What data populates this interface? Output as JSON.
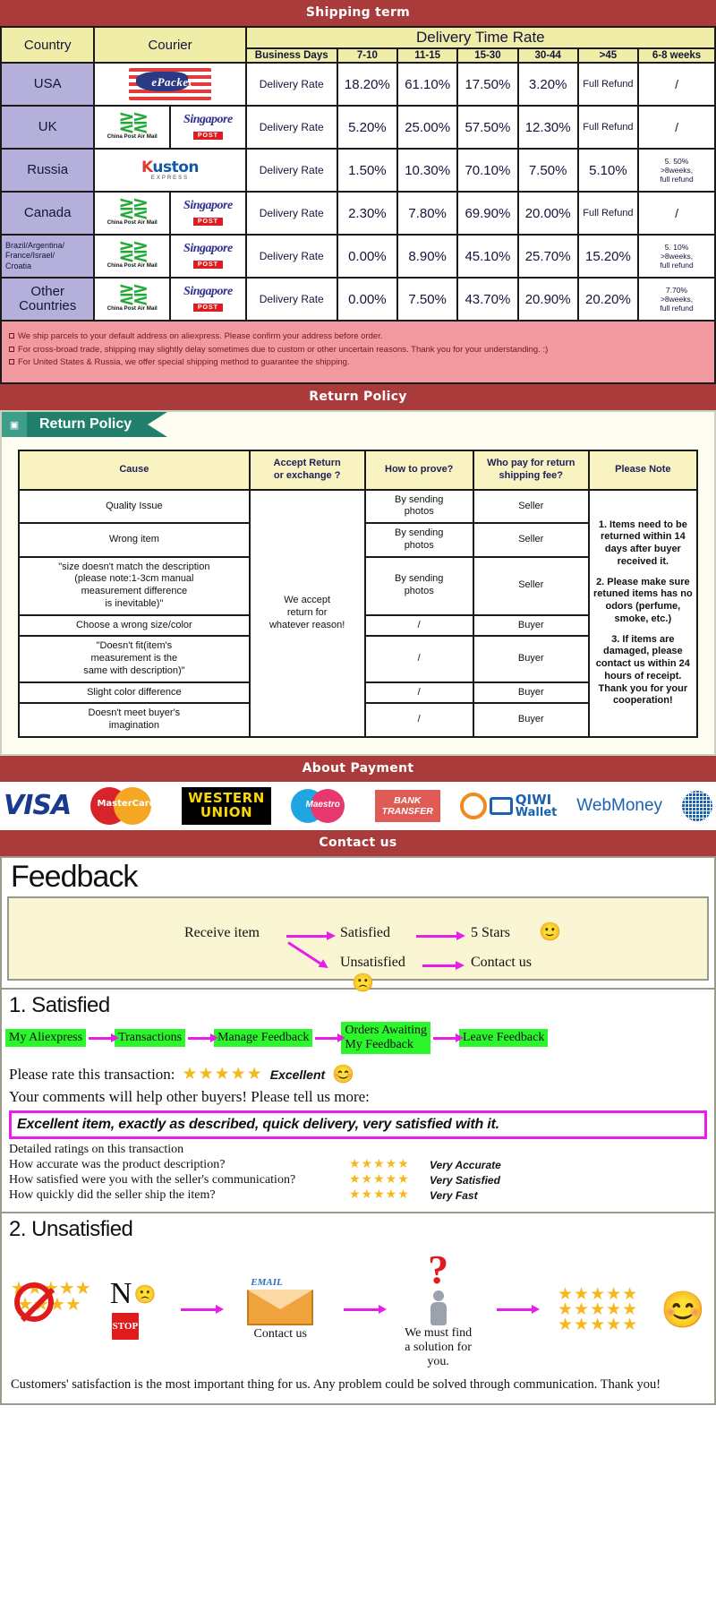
{
  "banners": {
    "shipping": "Shipping term",
    "return": "Return Policy",
    "payment": "About Payment",
    "contact": "Contact us"
  },
  "shipping_table": {
    "headers": {
      "country": "Country",
      "courier": "Courier",
      "delivery_time_rate": "Delivery Time Rate",
      "business_days": "Business Days",
      "ranges": [
        "7-10",
        "11-15",
        "15-30",
        "30-44",
        ">45",
        "6-8 weeks"
      ]
    },
    "rows": [
      {
        "country": "USA",
        "country_small": false,
        "couriers": [
          "epacket"
        ],
        "rate_label": "Delivery Rate",
        "values": [
          "18.20%",
          "61.10%",
          "17.50%",
          "3.20%",
          "Full Refund",
          "/"
        ],
        "last_note": ""
      },
      {
        "country": "UK",
        "country_small": false,
        "couriers": [
          "china-post-air-mail",
          "singapore-post"
        ],
        "rate_label": "Delivery Rate",
        "values": [
          "5.20%",
          "25.00%",
          "57.50%",
          "12.30%",
          "Full Refund",
          "/"
        ],
        "last_note": ""
      },
      {
        "country": "Russia",
        "country_small": false,
        "couriers": [
          "kuston-express"
        ],
        "rate_label": "Delivery Rate",
        "values": [
          "1.50%",
          "10.30%",
          "70.10%",
          "7.50%",
          "5.10%",
          ""
        ],
        "last_note": "5. 50%\n>8weeks,\nfull refund"
      },
      {
        "country": "Canada",
        "country_small": false,
        "couriers": [
          "china-post-air-mail",
          "singapore-post"
        ],
        "rate_label": "Delivery Rate",
        "values": [
          "2.30%",
          "7.80%",
          "69.90%",
          "20.00%",
          "Full Refund",
          "/"
        ],
        "last_note": ""
      },
      {
        "country": "Brazil/Argentina/\nFrance/Israel/\nCroatia",
        "country_small": true,
        "couriers": [
          "china-post-air-mail",
          "singapore-post"
        ],
        "rate_label": "Delivery Rate",
        "values": [
          "0.00%",
          "8.90%",
          "45.10%",
          "25.70%",
          "15.20%",
          ""
        ],
        "last_note": "5. 10%\n>8weeks,\nfull refund"
      },
      {
        "country": "Other Countries",
        "country_small": false,
        "couriers": [
          "china-post-air-mail",
          "singapore-post"
        ],
        "rate_label": "Delivery Rate",
        "values": [
          "0.00%",
          "7.50%",
          "43.70%",
          "20.90%",
          "20.20%",
          ""
        ],
        "last_note": "7.70%\n>8weeks,\nfull refund"
      }
    ],
    "notes": [
      "We ship parcels to your default address on aliexpress. Please confirm your address before order.",
      "For cross-broad trade, shipping may slightly delay sometimes due to custom or other uncertain reasons. Thank you for your understanding. :)",
      "For United States & Russia, we offer special shipping method to guarantee the shipping."
    ]
  },
  "return_policy": {
    "tag_label": "Return Policy",
    "headers": [
      "Cause",
      "Accept Return\nor exchange ?",
      "How to prove?",
      "Who pay for return\nshipping fee?",
      "Please Note"
    ],
    "accept_text": "We accept\nreturn for\nwhatever reason!",
    "rows": [
      {
        "cause": "Quality Issue",
        "prove": "By sending\nphotos",
        "who_pays": "Seller"
      },
      {
        "cause": "Wrong item",
        "prove": "By sending\nphotos",
        "who_pays": "Seller"
      },
      {
        "cause": "\"size doesn't match the description\n(please note:1-3cm manual\nmeasurement difference\nis inevitable)\"",
        "prove": "By sending\nphotos",
        "who_pays": "Seller"
      },
      {
        "cause": "Choose a wrong size/color",
        "prove": "/",
        "who_pays": "Buyer"
      },
      {
        "cause": "\"Doesn't fit(item's\nmeasurement is the\nsame with description)\"",
        "prove": "/",
        "who_pays": "Buyer"
      },
      {
        "cause": "Slight color difference",
        "prove": "/",
        "who_pays": "Buyer"
      },
      {
        "cause": "Doesn't meet buyer's\nimagination",
        "prove": "/",
        "who_pays": "Buyer"
      }
    ],
    "notes": [
      "1. Items need to be returned within 14 days after buyer received it.",
      "2. Please make sure retuned items has no odors (perfume, smoke, etc.)",
      "3. If items are damaged, please contact us within 24 hours of receipt. Thank you for your cooperation!"
    ]
  },
  "payment_methods": [
    {
      "name": "visa",
      "label": "VISA"
    },
    {
      "name": "mastercard",
      "label": "MasterCard"
    },
    {
      "name": "western-union",
      "label_line1": "WESTERN",
      "label_line2": "UNION"
    },
    {
      "name": "maestro",
      "label": "Maestro"
    },
    {
      "name": "bank-transfer",
      "label_line1": "BANK",
      "label_line2": "TRANSFER"
    },
    {
      "name": "qiwi-wallet",
      "label_line1": "QIWI",
      "label_line2": "Wallet"
    },
    {
      "name": "webmoney",
      "label": "WebMoney"
    },
    {
      "name": "globe",
      "label": ""
    }
  ],
  "feedback": {
    "title": "Feedback",
    "flow": {
      "receive": "Receive item",
      "satisfied": "Satisfied",
      "five_stars": "5 Stars",
      "unsatisfied": "Unsatisfied",
      "contact_us": "Contact us",
      "happy_emoji": "🙂",
      "sad_emoji": "🙁"
    },
    "satisfied": {
      "heading": "1. Satisfied",
      "steps": [
        "My Aliexpress",
        "Transactions",
        "Manage Feedback",
        "Orders Awaiting\nMy Feedback",
        "Leave Feedback"
      ],
      "rate_prompt": "Please rate this transaction:",
      "stars": "★★★★★",
      "rating_word": "Excellent",
      "rating_emoji": "😊",
      "comment_prompt": "Your comments will help other buyers! Please tell us more:",
      "comment_text": "Excellent item, exactly as described, quick delivery, very satisfied with it.",
      "details_title": "Detailed ratings on this transaction",
      "details": [
        {
          "question": "How accurate was the product description?",
          "stars": "★★★★★",
          "value": "Very Accurate"
        },
        {
          "question": "How satisfied were you with the seller's communication?",
          "stars": "★★★★★",
          "value": "Very Satisfied"
        },
        {
          "question": "How quickly did the seller ship the item?",
          "stars": "★★★★★",
          "value": "Very Fast"
        }
      ]
    },
    "unsatisfied": {
      "heading": "2. Unsatisfied",
      "no_label": "N",
      "stop_label": "STOP",
      "email_label": "EMAIL",
      "contact_us": "Contact us",
      "solution_text": "We must find\na solution for\nyou.",
      "smile_emoji": "😊",
      "footer": "Customers' satisfaction is the most important thing for us. Any problem could be solved through communication. Thank you!"
    }
  },
  "colors": {
    "banner_red": "#a93b3b",
    "header_yellow": "#f0eda8",
    "country_purple": "#b5b0db",
    "note_pink": "#f09aa0",
    "green_tag": "#21806c",
    "flow_green": "#2bf52b",
    "magenta": "#e81ee8",
    "star_gold": "#f5b91d"
  }
}
